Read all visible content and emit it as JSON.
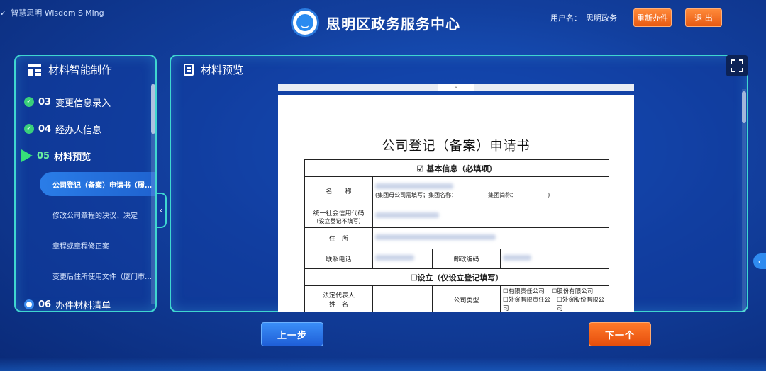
{
  "header": {
    "brand_small": "智慧思明  Wisdom SiMing",
    "app_title": "思明区政务服务中心",
    "user_label": "用户名：",
    "user_name": "思明政务",
    "restart_label": "重新办件",
    "exit_label": "退 出"
  },
  "left_panel": {
    "title": "材料智能制作",
    "steps": [
      {
        "num": "03",
        "label": "变更信息录入",
        "state": "done"
      },
      {
        "num": "04",
        "label": "经办人信息",
        "state": "done"
      },
      {
        "num": "05",
        "label": "材料预览",
        "state": "current"
      },
      {
        "num": "06",
        "label": "办件材料清单",
        "state": "todo"
      }
    ],
    "subitems": [
      "公司登记（备案）申请书（履…",
      "修改公司章程的决议、决定",
      "章程或章程修正案",
      "变更后住所使用文件（厦门市…"
    ]
  },
  "right_panel": {
    "title": "材料预览"
  },
  "document": {
    "title": "公司登记（备案）申请书",
    "section_basic": "☑ 基本信息（必填项）",
    "name_label": "名　　称",
    "group_hint": "(集团母公司需填写；集团名称：　　　　　　集团简称：　　　　　　)",
    "credit_code_label": "统一社会信用代码",
    "credit_code_hint": "（设立登记不填写）",
    "address_label": "住　所",
    "phone_label": "联系电话",
    "postcode_label": "邮政编码",
    "section_setup": "☐设立（仅设立登记填写）",
    "legal_rep_label1": "法定代表人",
    "legal_rep_label2": "姓　名",
    "company_type_label": "公司类型",
    "company_types": [
      "☐有限责任公司",
      "☐股份有限公司",
      "☐外资有限责任公司",
      "☐外资股份有限公司"
    ]
  },
  "buttons": {
    "prev": "上一步",
    "next": "下一个"
  },
  "colors": {
    "accent_border": "#3fd6d0",
    "orange_button": "#e85a12",
    "blue_button": "#1f5fd8",
    "done_dot": "#3ad07a"
  }
}
